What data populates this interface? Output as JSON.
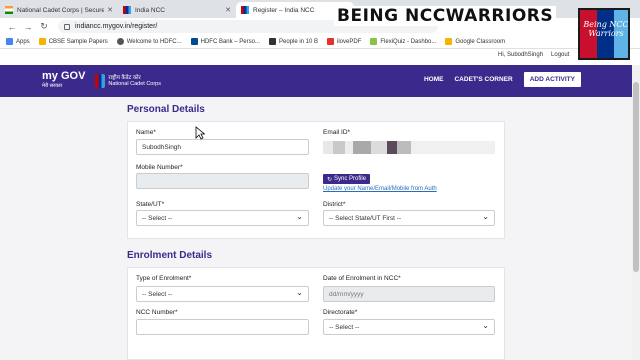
{
  "browser": {
    "tabs": [
      {
        "title": "National Cadet Corps | Secure, Sa",
        "icon": "india-flag-icon"
      },
      {
        "title": "India NCC",
        "icon": "ncc-icon"
      },
      {
        "title": "Register – India NCC",
        "icon": "ncc-icon"
      }
    ],
    "url": "indiancc.mygov.in/register/",
    "bookmarks": [
      {
        "label": "Apps",
        "color": "#4285f4"
      },
      {
        "label": "CBSE Sample Papers",
        "color": "#f4b400"
      },
      {
        "label": "Welcome to HDFC...",
        "color": "#555555"
      },
      {
        "label": "HDFC Bank – Perso...",
        "color": "#004c8f"
      },
      {
        "label": "People in 10 B",
        "color": "#333333"
      },
      {
        "label": "ilovePDF",
        "color": "#e5322d"
      },
      {
        "label": "FlexiQuiz - Dashbo...",
        "color": "#8bc34a"
      },
      {
        "label": "Google Classroom",
        "color": "#f4b400"
      }
    ],
    "user_greeting": "Hi, SubodhSingh",
    "logout": "Logout"
  },
  "overlay": {
    "title": "BEING NCCWARRIORS",
    "logo_text": "Being NCC Warriors"
  },
  "site": {
    "mygov_logo": "my GOV",
    "mygov_sub": "मेरी सरकार",
    "ncc_logo_hindi": "राष्ट्रीय कैडेट कोर",
    "ncc_logo_english": "National Cadet Corps",
    "nav": {
      "home": "HOME",
      "cadets_corner": "CADET'S CORNER",
      "add_activity": "ADD ACTIVITY"
    }
  },
  "personal": {
    "heading": "Personal Details",
    "name_label": "Name*",
    "name_value": "SubodhSingh",
    "email_label": "Email ID*",
    "mobile_label": "Mobile Number*",
    "sync_button": "Sync Profile",
    "sync_link": "Update your Name/Email/Mobile from Auth",
    "state_label": "State/UT*",
    "state_value": "-- Select --",
    "district_label": "District*",
    "district_value": "-- Select State/UT First --"
  },
  "enrolment": {
    "heading": "Enrolment Details",
    "type_label": "Type of Enrolment*",
    "type_value": "-- Select --",
    "date_label": "Date of Enrolment in NCC*",
    "date_placeholder": "dd/mm/yyyy",
    "ncc_number_label": "NCC Number*",
    "directorate_label": "Directorate*",
    "directorate_value": "-- Select --"
  }
}
